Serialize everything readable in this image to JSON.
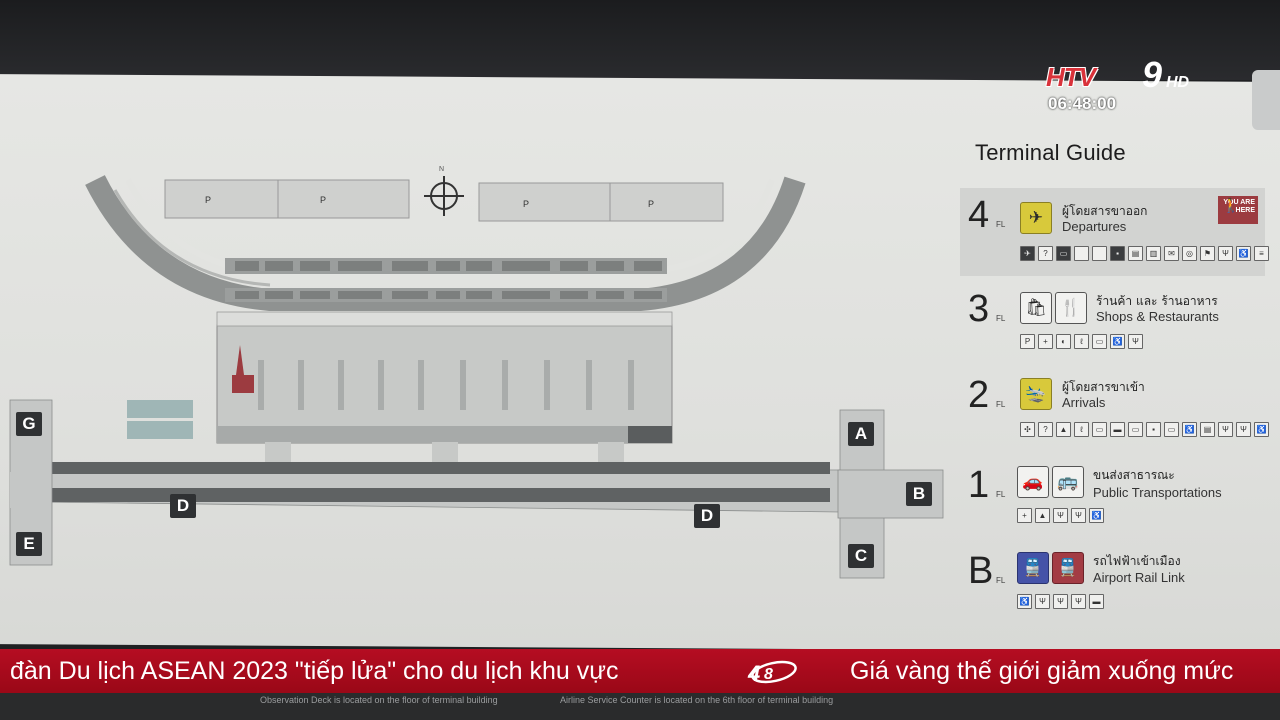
{
  "broadcast": {
    "logo": "HTV9HD",
    "logo_htv": "HTV",
    "logo_9": "9",
    "logo_hd": "HD",
    "clock": "06:48:00"
  },
  "guide": {
    "title": "Terminal Guide",
    "floors": [
      {
        "num": "4",
        "fl": "FL",
        "thai": "ผู้โดยสารขาออก",
        "en": "Departures",
        "current": true,
        "you_are_here": "YOU ARE HERE"
      },
      {
        "num": "3",
        "fl": "FL",
        "thai": "ร้านค้า และ ร้านอาหาร",
        "en": "Shops & Restaurants"
      },
      {
        "num": "2",
        "fl": "FL",
        "thai": "ผู้โดยสารขาเข้า",
        "en": "Arrivals"
      },
      {
        "num": "1",
        "fl": "FL",
        "thai": "ขนส่งสาธารณะ",
        "en": "Public Transportations"
      },
      {
        "num": "B",
        "fl": "FL",
        "thai": "รถไฟฟ้าเข้าเมือง",
        "en": "Airport Rail Link"
      }
    ]
  },
  "map": {
    "north": "N",
    "piers": [
      "G",
      "E",
      "D",
      "D",
      "A",
      "B",
      "C"
    ]
  },
  "ticker": {
    "left": "đàn Du lịch ASEAN 2023 \"tiếp lửa\" cho du lịch khu vực",
    "right": "Giá vàng thế giới giảm xuống mức"
  },
  "bottom": {
    "note_left": "Observation Deck is located on the floor of terminal building",
    "note_right": "Airline Service Counter is located on the 6th floor of terminal building"
  },
  "colors": {
    "ticker_red": "#b50d22",
    "departures_icon": "#d8c93b",
    "rail_blue": "#4553a8",
    "rail_red": "#a33c44",
    "you_are_here": "#9c3b40"
  }
}
